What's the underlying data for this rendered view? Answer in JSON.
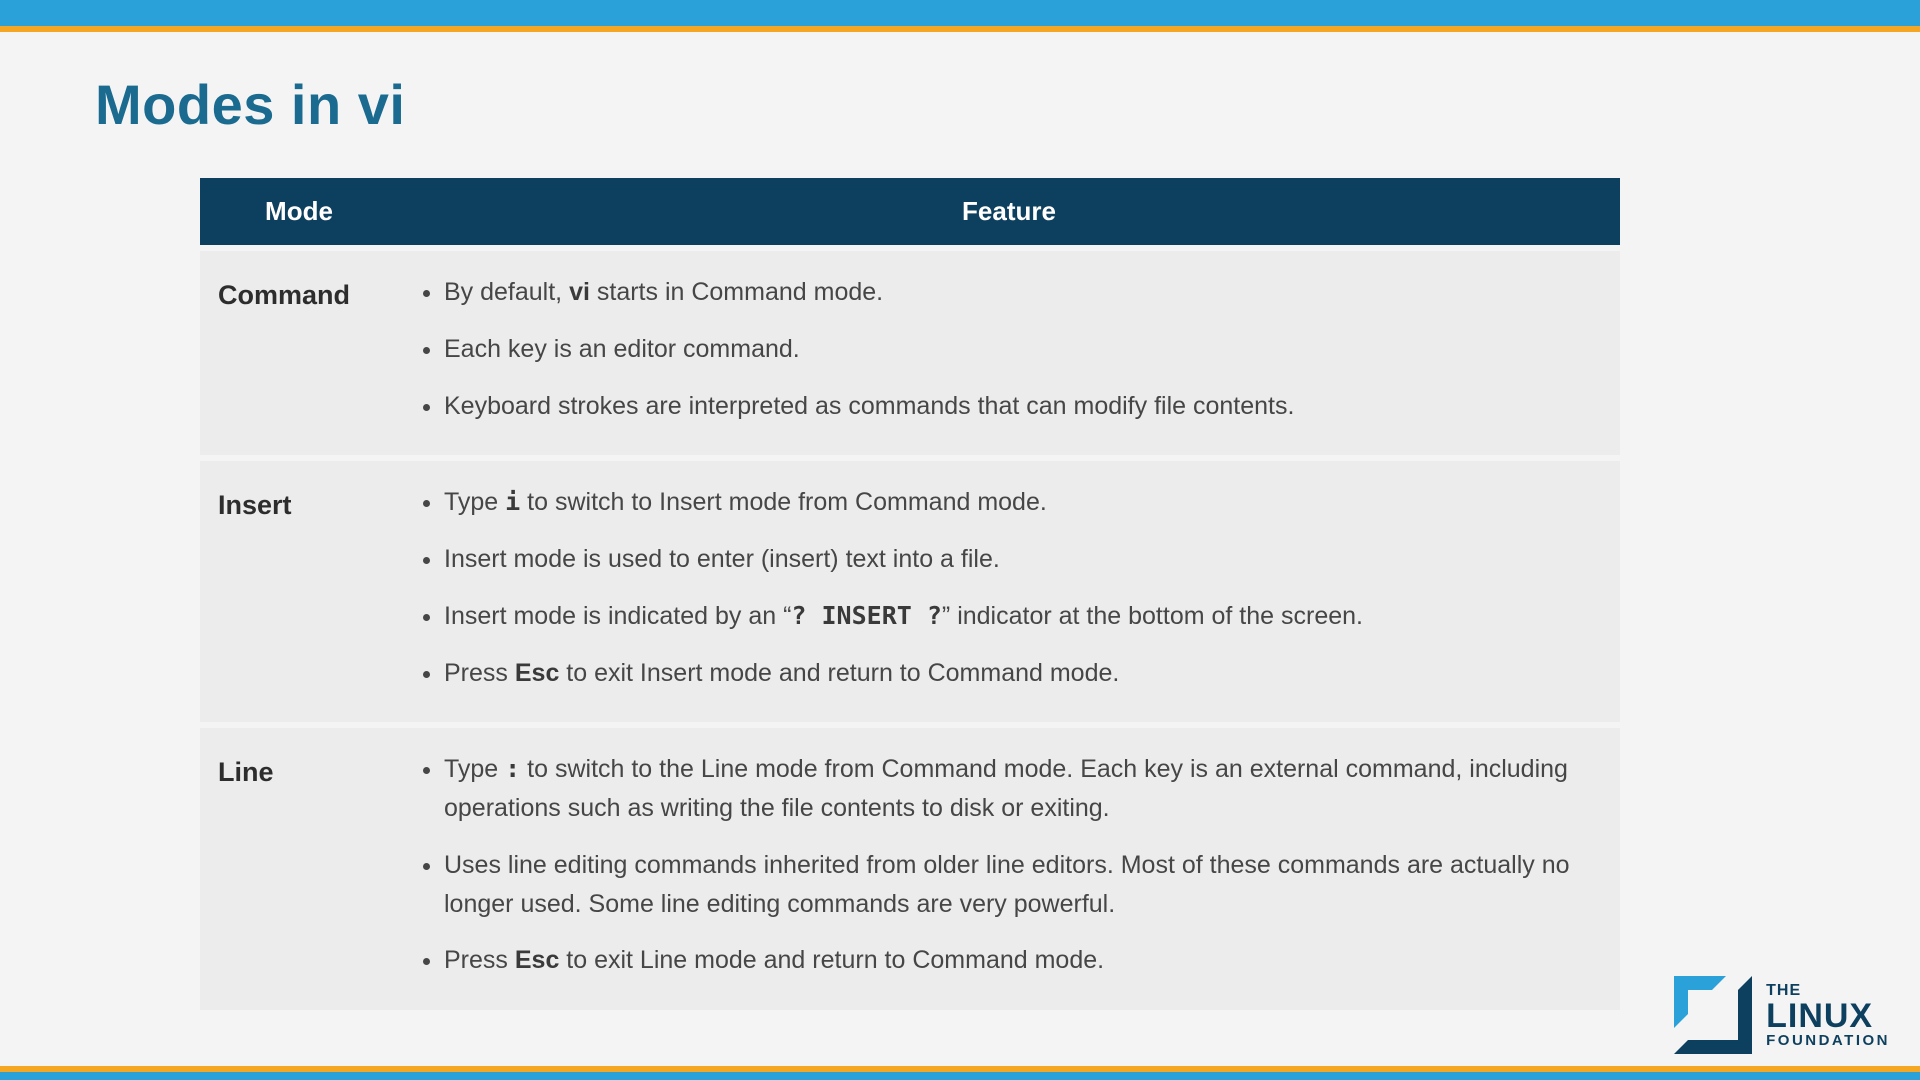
{
  "title": "Modes in vi",
  "table": {
    "headers": {
      "mode": "Mode",
      "feature": "Feature"
    },
    "rows": [
      {
        "mode": "Command",
        "items": [
          {
            "pre": "By default, ",
            "bold": "vi",
            "post": " starts in Command mode."
          },
          {
            "pre": "Each key is an editor command."
          },
          {
            "pre": "Keyboard strokes are interpreted as commands that can modify file contents."
          }
        ]
      },
      {
        "mode": "Insert",
        "items": [
          {
            "pre": "Type ",
            "mono": "i",
            "post": " to switch to Insert mode from Command mode."
          },
          {
            "pre": "Insert mode is used to enter (insert) text into a file."
          },
          {
            "pre": "Insert mode is indicated by an “",
            "mono": "? INSERT ?",
            "post": "” indicator at the bottom of the screen."
          },
          {
            "pre": "Press ",
            "bold": "Esc",
            "post": " to exit Insert mode and return to Command mode."
          }
        ]
      },
      {
        "mode": "Line",
        "items": [
          {
            "pre": "Type ",
            "mono": ":",
            "post": " to switch to the Line mode from Command mode. Each key is an external command, including operations such as writing the file contents to disk or exiting."
          },
          {
            "pre": "Uses line editing commands inherited from older line editors. Most of these commands are actually no longer used. Some line editing commands are very powerful."
          },
          {
            "pre": "Press ",
            "bold": "Esc",
            "post": " to exit Line mode and return to Command mode."
          }
        ]
      }
    ]
  },
  "logo": {
    "the": "THE",
    "linux": "LINUX",
    "foundation": "FOUNDATION"
  }
}
